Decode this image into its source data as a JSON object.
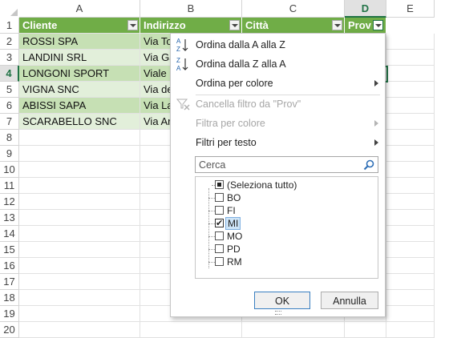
{
  "columns": [
    {
      "letter": "A",
      "selected": false
    },
    {
      "letter": "B",
      "selected": false
    },
    {
      "letter": "C",
      "selected": false
    },
    {
      "letter": "D",
      "selected": true
    },
    {
      "letter": "E",
      "selected": false
    }
  ],
  "rows": [
    "1",
    "2",
    "3",
    "4",
    "5",
    "6",
    "7",
    "8",
    "9",
    "10",
    "11",
    "12",
    "13",
    "14",
    "15",
    "16",
    "17",
    "18",
    "19",
    "20"
  ],
  "selected_row": "4",
  "headers": {
    "a": "Cliente",
    "b": "Indirizzo",
    "c": "Città",
    "d": "Prov"
  },
  "table": [
    {
      "cliente": "ROSSI SPA",
      "indirizzo": "Via To"
    },
    {
      "cliente": "LANDINI SRL",
      "indirizzo": "Via Ga"
    },
    {
      "cliente": "LONGONI SPORT",
      "indirizzo": "Viale"
    },
    {
      "cliente": "VIGNA SNC",
      "indirizzo": "Via de"
    },
    {
      "cliente": "ABISSI SAPA",
      "indirizzo": "Via La"
    },
    {
      "cliente": "SCARABELLO SNC",
      "indirizzo": "Via Ar"
    }
  ],
  "menu": {
    "sort_asc": "Ordina dalla A alla Z",
    "sort_desc": "Ordina dalla Z alla A",
    "sort_color": "Ordina per colore",
    "clear_filter": "Cancella filtro da \"Prov\"",
    "filter_color": "Filtra per colore",
    "text_filters": "Filtri per testo",
    "sort_icon_az": "sort-a-to-z-icon",
    "sort_icon_za": "sort-z-to-a-icon",
    "clear_icon": "clear-filter-icon"
  },
  "search": {
    "placeholder": "Cerca",
    "icon": "search-icon"
  },
  "filter_items": [
    {
      "label": "(Seleziona tutto)",
      "state": "partial"
    },
    {
      "label": "BO",
      "state": "unchecked"
    },
    {
      "label": "FI",
      "state": "unchecked"
    },
    {
      "label": "MI",
      "state": "checked"
    },
    {
      "label": "MO",
      "state": "unchecked"
    },
    {
      "label": "PD",
      "state": "unchecked"
    },
    {
      "label": "RM",
      "state": "unchecked"
    }
  ],
  "buttons": {
    "ok": "OK",
    "cancel": "Annulla"
  },
  "colors": {
    "header_green": "#70ad47",
    "band_dark": "#c6e0b4",
    "band_light": "#e2efda",
    "excel_green": "#217346"
  }
}
